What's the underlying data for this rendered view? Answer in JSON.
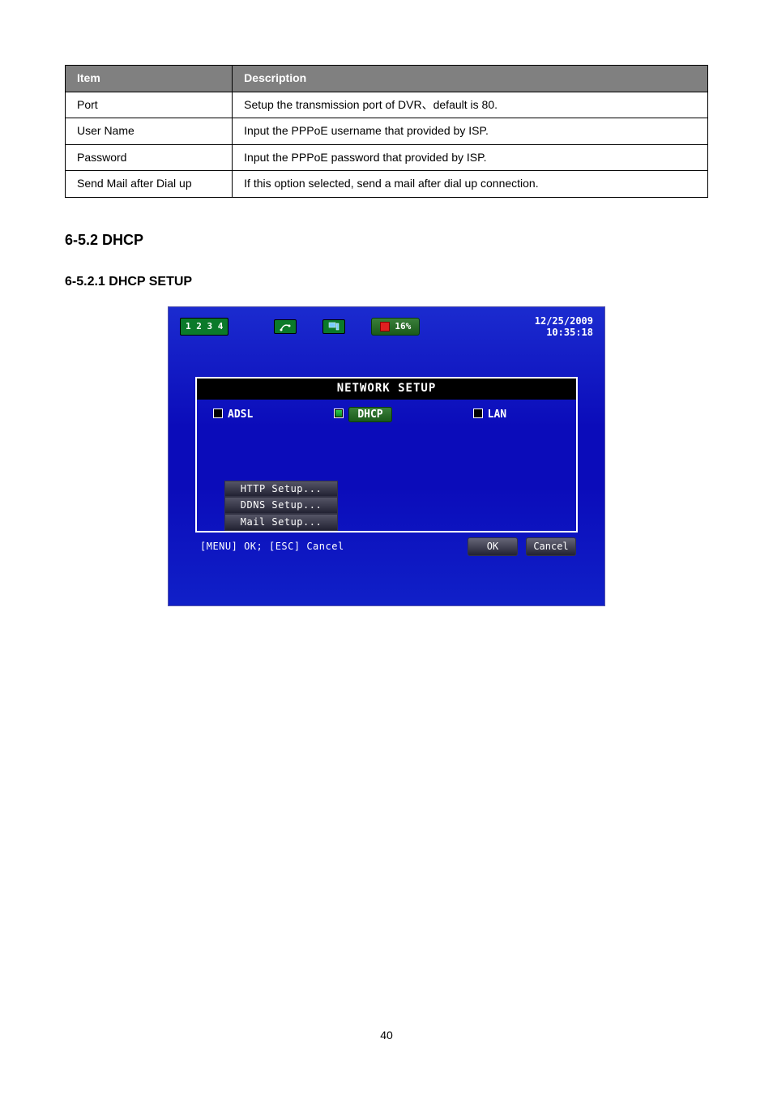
{
  "page_number": "40",
  "table": {
    "heads": [
      "Item",
      "Description"
    ],
    "rows": [
      [
        "Port",
        "Setup the transmission port of DVR、default is 80."
      ],
      [
        "User Name",
        "Input the PPPoE username that provided by ISP."
      ],
      [
        "Password",
        "Input the PPPoE password that provided by ISP."
      ],
      [
        "Send Mail after Dial up",
        "If this option selected, send a mail after dial up connection."
      ]
    ]
  },
  "sections": {
    "num": "6-5.2 DHCP",
    "sub": "6-5.2.1 DHCP SETUP"
  },
  "dvr": {
    "channels": "1 2 3 4",
    "pct": "16%",
    "date": "12/25/2009",
    "time": "10:35:18",
    "panel_title": "NETWORK SETUP",
    "opts": {
      "adsl": "ADSL",
      "dhcp": "DHCP",
      "lan": "LAN"
    },
    "btns": {
      "http": "HTTP Setup...",
      "ddns": "DDNS Setup...",
      "mail": "Mail Setup..."
    },
    "hint": "[MENU] OK; [ESC] Cancel",
    "ok": "OK",
    "cancel": "Cancel"
  }
}
